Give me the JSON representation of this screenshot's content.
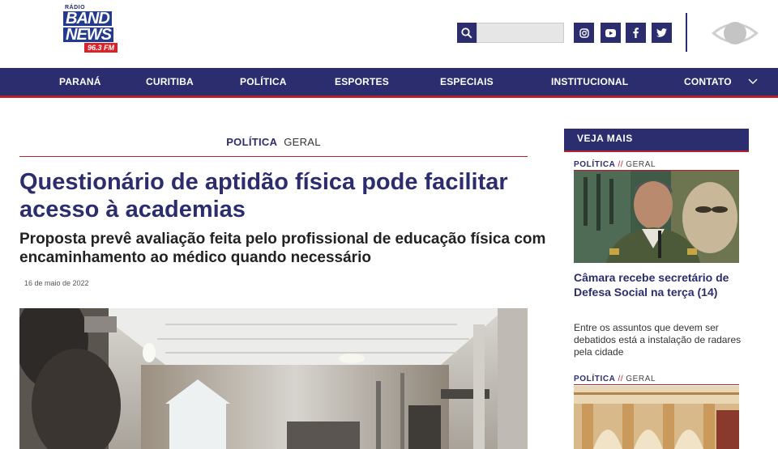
{
  "brand": {
    "radio": "RÁDIO",
    "band": "BAND",
    "news": "NEWS",
    "freq": "96.3 FM",
    "colors": {
      "primary": "#2b2d6e",
      "accent": "#b31f2e"
    }
  },
  "search": {
    "placeholder": "",
    "icon": "search-icon"
  },
  "social": [
    "instagram-icon",
    "youtube-icon",
    "facebook-icon",
    "twitter-icon"
  ],
  "nav": {
    "items": [
      "PARANÁ",
      "CURITIBA",
      "POLÍTICA",
      "ESPORTES",
      "ESPECIAIS",
      "INSTITUCIONAL",
      "CONTATO"
    ]
  },
  "article": {
    "category": "POLÍTICA",
    "subcategory": "GERAL",
    "headline": "Questionário de aptidão física pode facilitar acesso à academias",
    "subheadline": "Proposta prevê avaliação feita pelo profissional de educação física com encaminhamento ao médico quando necessário",
    "date": "16 de maio de 2022"
  },
  "sidebar": {
    "heading": "VEJA MAIS",
    "items": [
      {
        "category": "POLÍTICA",
        "separator": "//",
        "subcategory": "GERAL",
        "title": "Câmara recebe secretário de Defesa Social na terça (14)",
        "description": "Entre os assuntos que devem ser debatidos está a instalação de radares pela cidade"
      },
      {
        "category": "POLÍTICA",
        "separator": "//",
        "subcategory": "GERAL"
      }
    ]
  }
}
